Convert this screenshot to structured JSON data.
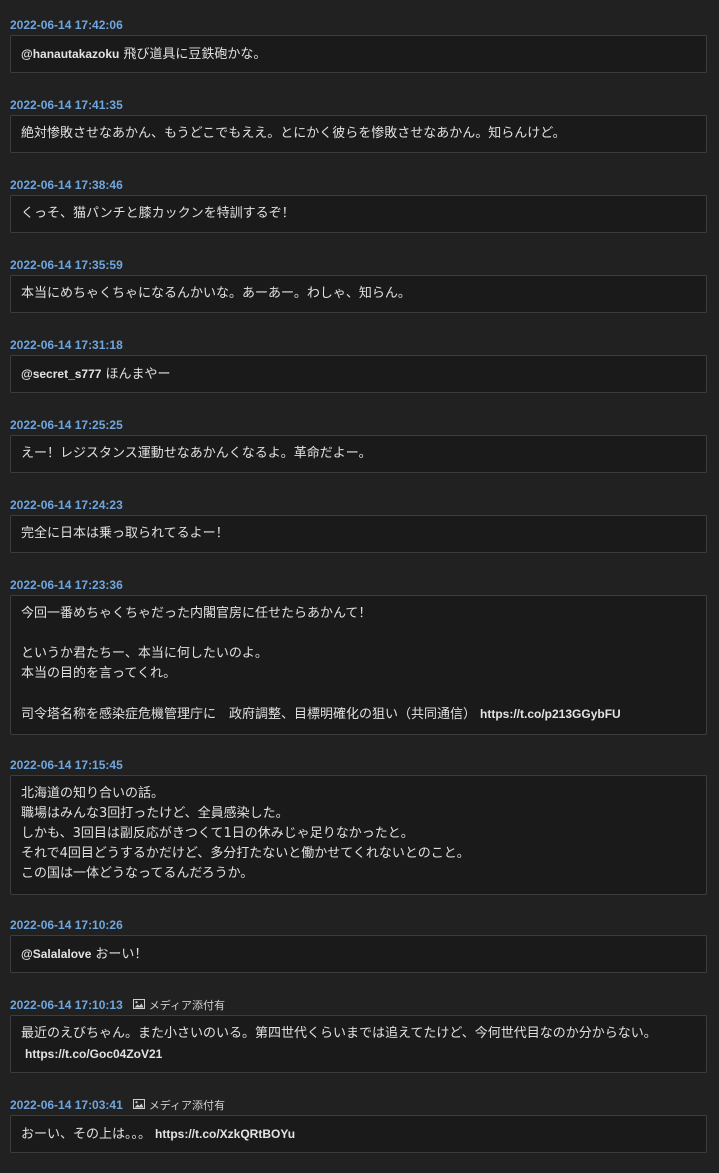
{
  "media_label": "メディア添付有",
  "posts": [
    {
      "timestamp": "2022-06-14 17:42:06",
      "mention": "@hanautakazoku",
      "text": "飛び道具に豆鉄砲かな。"
    },
    {
      "timestamp": "2022-06-14 17:41:35",
      "text": "絶対惨敗させなあかん、もうどこでもええ。とにかく彼らを惨敗させなあかん。知らんけど。"
    },
    {
      "timestamp": "2022-06-14 17:38:46",
      "text": "くっそ、猫パンチと膝カックンを特訓するぞ！"
    },
    {
      "timestamp": "2022-06-14 17:35:59",
      "text": "本当にめちゃくちゃになるんかいな。あーあー。わしゃ、知らん。"
    },
    {
      "timestamp": "2022-06-14 17:31:18",
      "mention": "@secret_s777",
      "text": "ほんまやー"
    },
    {
      "timestamp": "2022-06-14 17:25:25",
      "text": "えー！レジスタンス運動せなあかんくなるよ。革命だよー。"
    },
    {
      "timestamp": "2022-06-14 17:24:23",
      "text": "完全に日本は乗っ取られてるよー！"
    },
    {
      "timestamp": "2022-06-14 17:23:36",
      "lines": [
        "今回一番めちゃくちゃだった内閣官房に任せたらあかんて！",
        "",
        "というか君たちー、本当に何したいのよ。",
        "本当の目的を言ってくれ。",
        "",
        "司令塔名称を感染症危機管理庁に　政府調整、目標明確化の狙い（共同通信）"
      ],
      "link": "https://t.co/p213GGybFU"
    },
    {
      "timestamp": "2022-06-14 17:15:45",
      "lines": [
        "北海道の知り合いの話。",
        "職場はみんな3回打ったけど、全員感染した。",
        "しかも、3回目は副反応がきつくて1日の休みじゃ足りなかったと。",
        "それで4回目どうするかだけど、多分打たないと働かせてくれないとのこと。",
        "この国は一体どうなってるんだろうか。"
      ]
    },
    {
      "timestamp": "2022-06-14 17:10:26",
      "mention": "@Salalalove",
      "text": "おーい！"
    },
    {
      "timestamp": "2022-06-14 17:10:13",
      "media": true,
      "text": "最近のえびちゃん。また小さいのいる。第四世代くらいまでは追えてたけど、今何世代目なのか分からない。",
      "link": "https://t.co/Goc04ZoV21"
    },
    {
      "timestamp": "2022-06-14 17:03:41",
      "media": true,
      "text": "おーい、その上は。。。",
      "link": "https://t.co/XzkQRtBOYu"
    }
  ]
}
